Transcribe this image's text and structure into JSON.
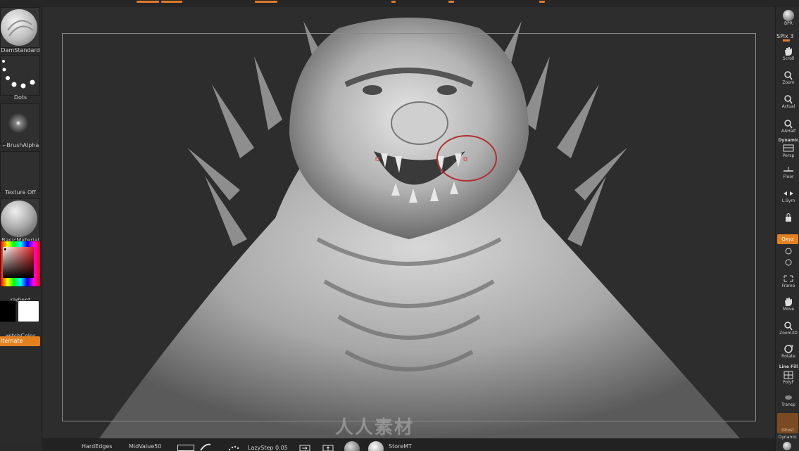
{
  "left_shelf": {
    "brush_label": "DamStandard",
    "stroke_label": "Dots",
    "alpha_label": "~BrushAlpha",
    "texture_label": "Texture Off",
    "material_label": "BasicMaterial",
    "gradient_label": "radient",
    "switchcolor_label": "witchColor",
    "alternate_label": "lternate"
  },
  "right_shelf": {
    "bpr": "BPR",
    "spix": "SPix 3",
    "scroll": "Scroll",
    "zoom": "Zoom",
    "actual": "Actual",
    "aahalf": "AAHalf",
    "dynamic": "Dynamic",
    "persp": "Persp",
    "floor": "Floor",
    "lsym": "L.Sym",
    "xyz": "Qxyz",
    "frame": "Frame",
    "move": "Move",
    "zoom3d": "Zoom3D",
    "rotate": "Rotate",
    "linefill": "Line Fill",
    "polyf": "PolyF",
    "transp": "Transp",
    "ghost": "Ghost",
    "dynamic2": "Dynamic"
  },
  "bottom_bar": {
    "hardedges": "HardEdges",
    "midvalue": "MidValue50",
    "lazystep": "LazyStep 0.05",
    "storemt": "StoreMT"
  },
  "watermark": "人人素材",
  "colors": {
    "accent": "#e4811f",
    "background": "#2d2d2d",
    "panel": "#2b2b2b"
  }
}
